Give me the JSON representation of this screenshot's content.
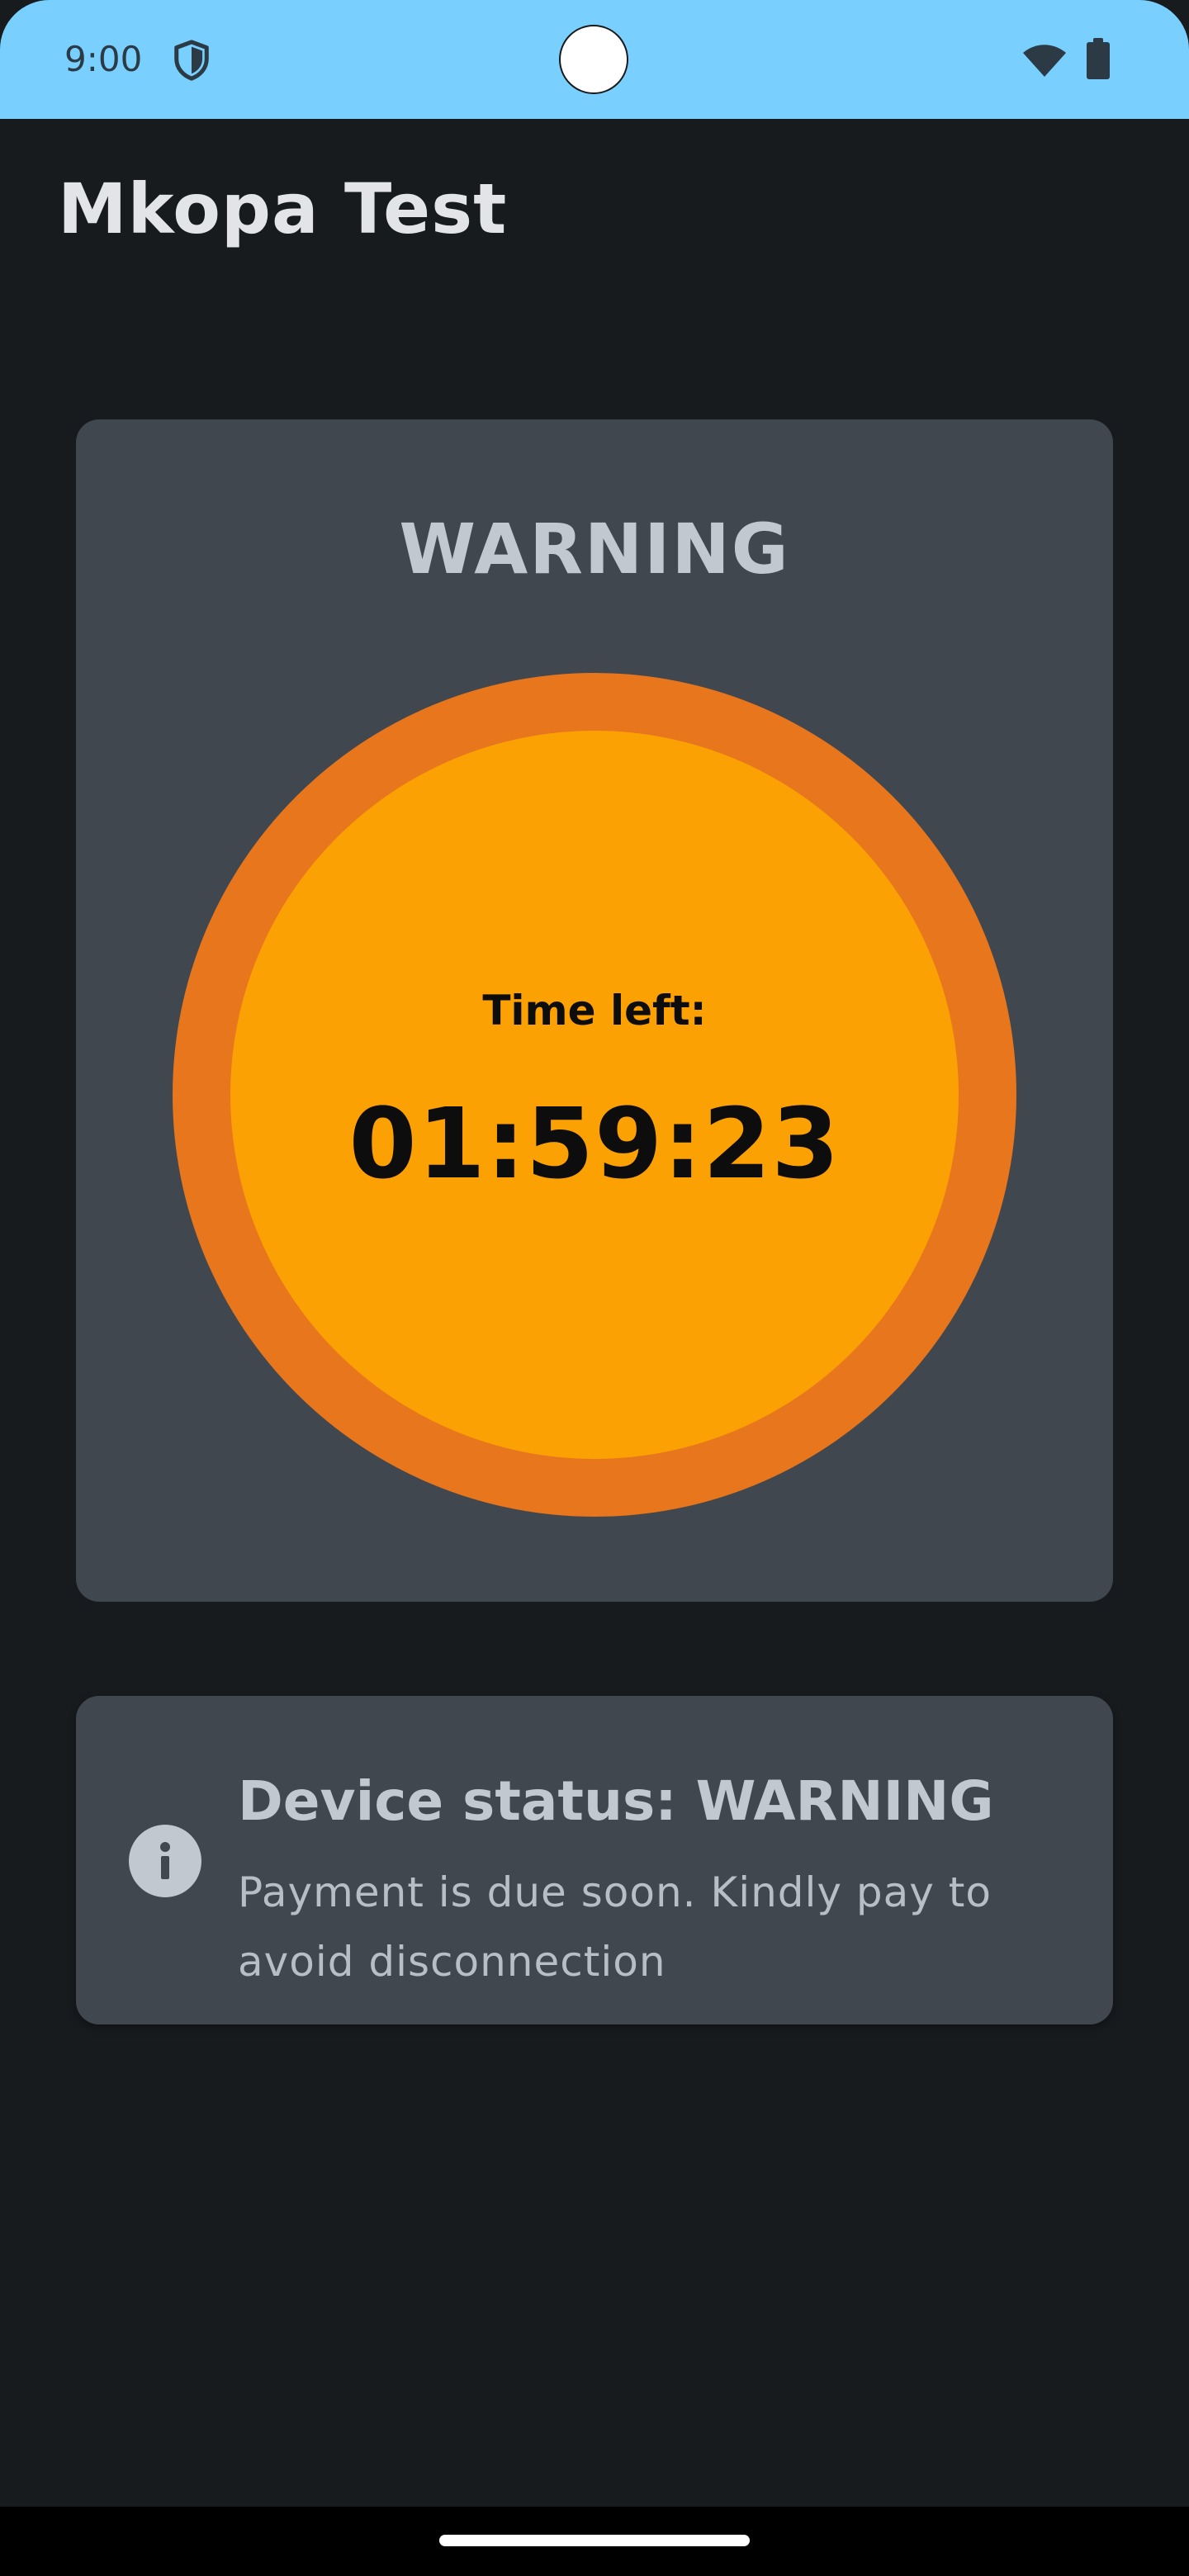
{
  "status_bar": {
    "time": "9:00",
    "icons": [
      "shield-icon",
      "wifi-icon",
      "battery-icon"
    ],
    "background_color": "#79d0fe"
  },
  "app": {
    "title": "Mkopa Test"
  },
  "warning_card": {
    "heading": "WARNING",
    "time_left_label": "Time left:",
    "time_left_value": "01:59:23",
    "ring_color": "#e7761c",
    "core_color": "#fca103"
  },
  "status_card": {
    "icon": "info-icon",
    "heading": "Device status: WARNING",
    "message": "Payment is due soon. Kindly pay to avoid disconnection"
  },
  "nav_bar": {
    "icon": "home-handle"
  }
}
